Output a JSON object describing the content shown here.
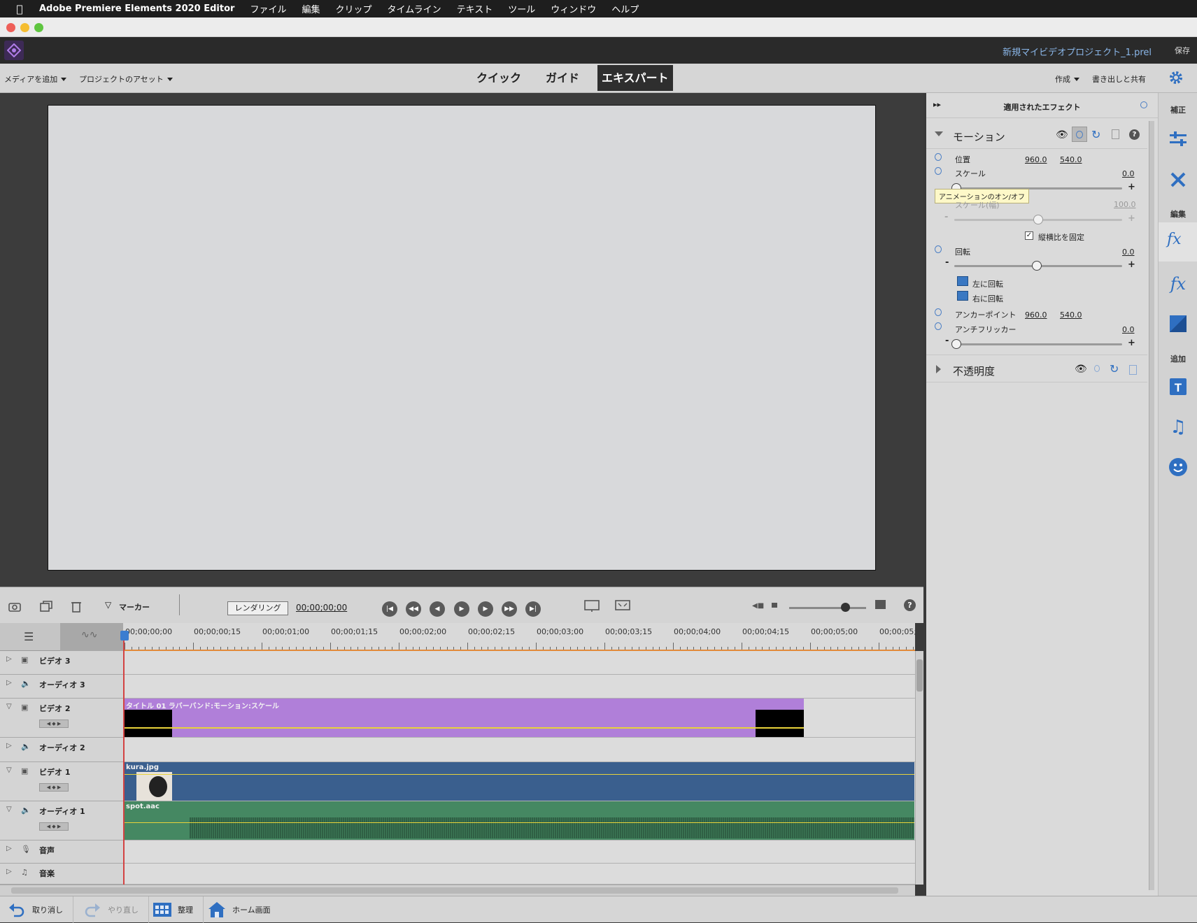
{
  "menubar": {
    "app_name": "Adobe Premiere Elements 2020 Editor",
    "items": [
      "ファイル",
      "編集",
      "クリップ",
      "タイムライン",
      "テキスト",
      "ツール",
      "ウィンドウ",
      "ヘルプ"
    ]
  },
  "header": {
    "project_name": "新規マイビデオプロジェクト_1.prel",
    "save_label": "保存"
  },
  "modebar": {
    "add_media": "メディアを追加",
    "project_assets": "プロジェクトのアセット",
    "modes": [
      "クイック",
      "ガイド",
      "エキスパート"
    ],
    "active_mode": "エキスパート",
    "create": "作成",
    "export_share": "書き出しと共有"
  },
  "effects_panel": {
    "title": "適用されたエフェクト",
    "motion": {
      "name": "モーション",
      "position_label": "位置",
      "position_x": "960.0",
      "position_y": "540.0",
      "scale_label": "スケール",
      "scale_value": "0.0",
      "scale_width_label": "スケール(幅)",
      "scale_width_value": "100.0",
      "lock_aspect_label": "縦横比を固定",
      "rotation_label": "回転",
      "rotation_value": "0.0",
      "rotate_left": "左に回転",
      "rotate_right": "右に回転",
      "anchor_label": "アンカーポイント",
      "anchor_x": "960.0",
      "anchor_y": "540.0",
      "antiflicker_label": "アンチフリッカー",
      "antiflicker_value": "0.0"
    },
    "opacity": {
      "name": "不透明度"
    },
    "tooltip": "アニメーションのオン/オフ"
  },
  "right_strip": {
    "adjust_label": "補正",
    "edit_label": "編集",
    "add_label": "追加"
  },
  "transport": {
    "marker_label": "マーカー",
    "render_label": "レンダリング",
    "timecode": "00;00;00;00"
  },
  "timeline": {
    "ruler_labels": [
      "00;00;00;00",
      "00;00;00;15",
      "00;00;01;00",
      "00;00;01;15",
      "00;00;02;00",
      "00;00;02;15",
      "00;00;03;00",
      "00;00;03;15",
      "00;00;04;00",
      "00;00;04;15",
      "00;00;05;00",
      "00;00;05;"
    ],
    "tracks": [
      {
        "name": "ビデオ 3"
      },
      {
        "name": "オーディオ 3"
      },
      {
        "name": "ビデオ 2",
        "clip": "タイトル 01 ラバーバンド:モーション:スケール"
      },
      {
        "name": "オーディオ 2"
      },
      {
        "name": "ビデオ 1",
        "clip": "kura.jpg"
      },
      {
        "name": "オーディオ 1",
        "clip": "spot.aac"
      },
      {
        "name": "音声"
      },
      {
        "name": "音楽"
      }
    ]
  },
  "bottombar": {
    "undo": "取り消し",
    "redo": "やり直し",
    "organize": "整理",
    "home": "ホーム画面"
  }
}
